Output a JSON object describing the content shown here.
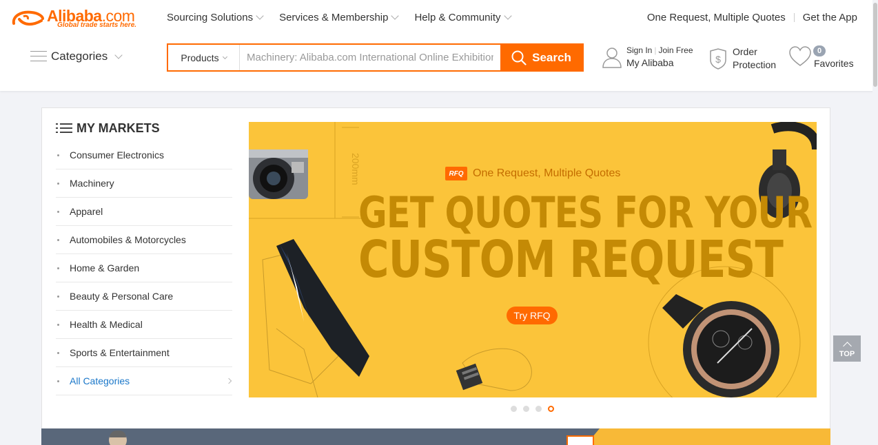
{
  "brand": {
    "name": "Alibaba",
    "domain_suffix": ".com",
    "tagline": "Global trade starts here.",
    "accent_color": "#ff6a00"
  },
  "topnav": {
    "items": [
      {
        "label": "Sourcing Solutions"
      },
      {
        "label": "Services & Membership"
      },
      {
        "label": "Help & Community"
      }
    ],
    "right_links": [
      {
        "label": "One Request, Multiple Quotes"
      },
      {
        "label": "Get the App"
      }
    ]
  },
  "categories": {
    "label": "Categories"
  },
  "search": {
    "type_label": "Products",
    "placeholder": "Machinery: Alibaba.com International Online Exhibition",
    "button_label": "Search"
  },
  "account": {
    "sign_in": "Sign In",
    "join_free": "Join Free",
    "my_alibaba": "My Alibaba"
  },
  "order_protection": {
    "line1": "Order",
    "line2": "Protection"
  },
  "favorites": {
    "count": "0",
    "label": "Favorites"
  },
  "markets": {
    "title": "MY MARKETS",
    "items": [
      {
        "label": "Consumer Electronics"
      },
      {
        "label": "Machinery"
      },
      {
        "label": "Apparel"
      },
      {
        "label": "Automobiles & Motorcycles"
      },
      {
        "label": "Home & Garden"
      },
      {
        "label": "Beauty & Personal Care"
      },
      {
        "label": "Health & Medical"
      },
      {
        "label": "Sports & Entertainment"
      }
    ],
    "all_label": "All Categories"
  },
  "banner": {
    "rfq_logo": "RFQ",
    "tagline": "One Request, Multiple Quotes",
    "headline_1": "GET QUOTES FOR YOUR",
    "headline_2": "CUSTOM REQUEST",
    "cta": "Try RFQ",
    "measure_label": "200mm",
    "background_color": "#fbc43a",
    "slides_total": 4,
    "active_slide": 4
  },
  "back_to_top": {
    "label": "TOP"
  }
}
